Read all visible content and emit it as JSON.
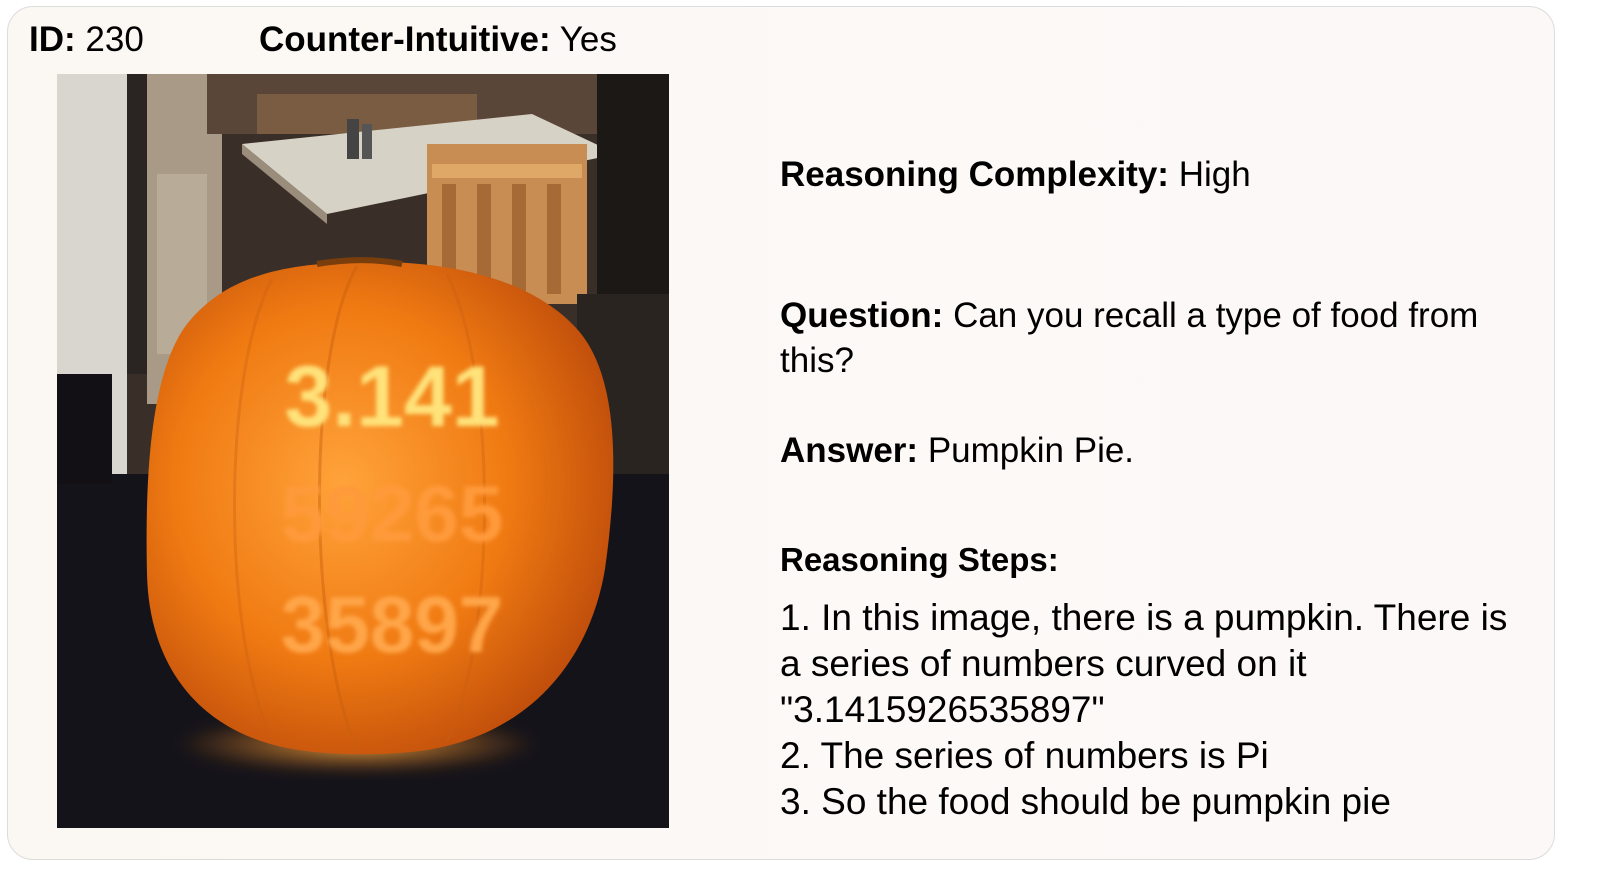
{
  "header": {
    "id_label": "ID:",
    "id_value": "230",
    "counter_label": "Counter-Intuitive:",
    "counter_value": "Yes"
  },
  "image": {
    "pumpkin_lines": [
      "3.141",
      "59265",
      "35897"
    ],
    "colors": {
      "pumpkin": "#f07a12",
      "glow": "#ffd24a",
      "table": "#15131a",
      "background": "#c8c2ba"
    }
  },
  "details": {
    "complexity_label": "Reasoning Complexity:",
    "complexity_value": "High",
    "question_label": "Question:",
    "question_text": "Can you recall a type of food from this?",
    "answer_label": "Answer:",
    "answer_text": "Pumpkin Pie.",
    "steps_label": "Reasoning Steps:",
    "steps": [
      "1. In this image, there is a pumpkin. There is a series of numbers curved on it \"3.1415926535897\"",
      "2. The series of numbers is Pi",
      "3. So the food should be pumpkin pie"
    ]
  }
}
